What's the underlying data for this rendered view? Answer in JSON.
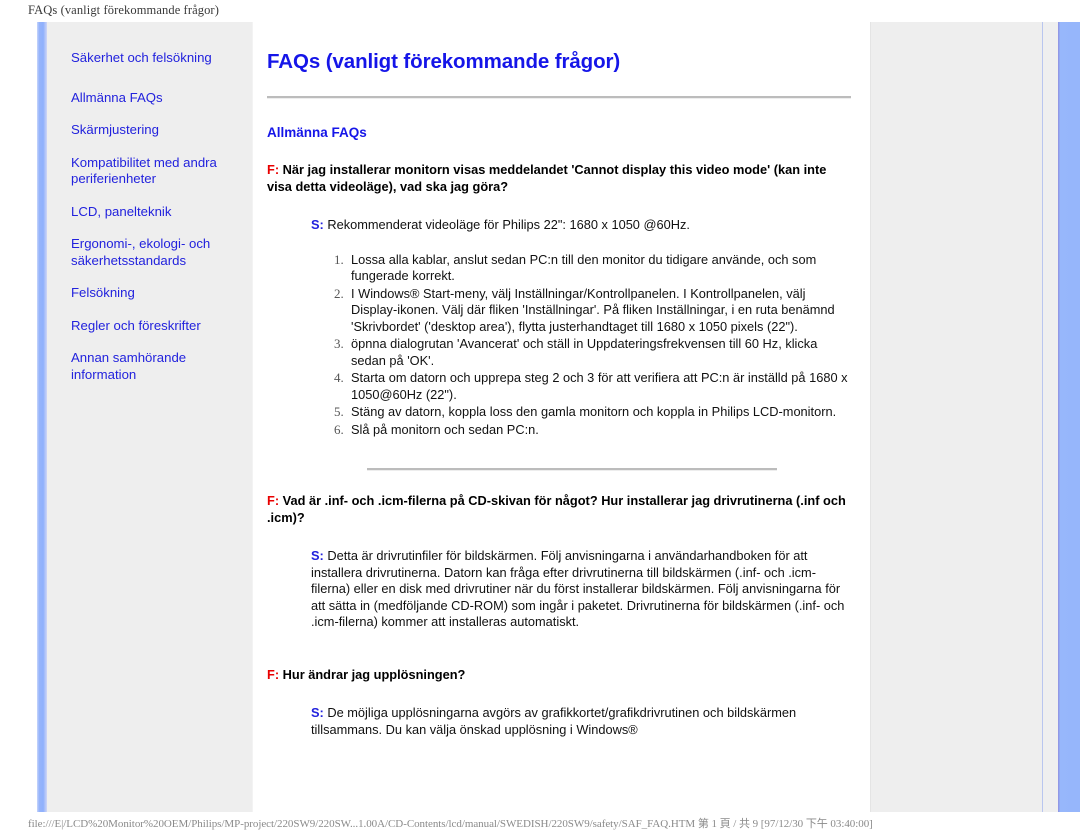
{
  "window": {
    "caption": "FAQs (vanligt förekommande frågor)",
    "footer": "file:///E|/LCD%20Monitor%20OEM/Philips/MP-project/220SW9/220SW...1.00A/CD-Contents/lcd/manual/SWEDISH/220SW9/safety/SAF_FAQ.HTM 第 1 頁 / 共 9 [97/12/30 下午 03:40:00]"
  },
  "colors": {
    "link": "#2222dd",
    "title": "#1515e8",
    "question_marker": "#e80000",
    "answer_marker": "#2222dd",
    "sidebar_bg": "#eeeeee",
    "accent_bar": "#96b4fb"
  },
  "sidebar": {
    "items": [
      {
        "label": "Säkerhet och felsökning"
      },
      {
        "label": "Allmänna FAQs"
      },
      {
        "label": "Skärmjustering"
      },
      {
        "label": "Kompatibilitet med andra periferienheter"
      },
      {
        "label": "LCD, panelteknik"
      },
      {
        "label": "Ergonomi-, ekologi- och säkerhetsstandards"
      },
      {
        "label": "Felsökning"
      },
      {
        "label": "Regler och föreskrifter"
      },
      {
        "label": "Annan samhörande information"
      }
    ]
  },
  "main": {
    "title": "FAQs (vanligt förekommande frågor)",
    "section_title": "Allmänna FAQs",
    "q_marker": "F:",
    "a_marker": "S:",
    "qa": [
      {
        "question": "När jag installerar monitorn visas meddelandet 'Cannot display this video mode' (kan inte visa detta videoläge), vad ska jag göra?",
        "answer": "Rekommenderat videoläge för Philips 22\": 1680 x 1050 @60Hz.",
        "steps": [
          "Lossa alla kablar, anslut sedan PC:n till den monitor du tidigare använde, och som fungerade korrekt.",
          "I Windows® Start-meny, välj Inställningar/Kontrollpanelen. I Kontrollpanelen, välj Display-ikonen. Välj där fliken 'Inställningar'. På fliken Inställningar, i en ruta benämnd 'Skrivbordet' ('desktop area'), flytta justerhandtaget till 1680 x 1050 pixels (22\").",
          "öpnna dialogrutan 'Avancerat' och ställ in Uppdateringsfrekvensen till 60 Hz, klicka sedan på 'OK'.",
          "Starta om datorn och upprepa steg 2 och 3 för att verifiera att PC:n är inställd på 1680 x 1050@60Hz (22\").",
          "Stäng av datorn, koppla loss den gamla monitorn och koppla in Philips LCD-monitorn.",
          "Slå på monitorn och sedan PC:n."
        ]
      },
      {
        "question": "Vad är .inf- och .icm-filerna på CD-skivan för något? Hur installerar jag drivrutinerna (.inf och .icm)?",
        "answer": "Detta är drivrutinfiler för bildskärmen. Följ anvisningarna i användarhandboken för att installera drivrutinerna. Datorn kan fråga efter drivrutinerna till bildskärmen (.inf- och .icm-filerna) eller en disk med drivrutiner när du först installerar bildskärmen. Följ anvisningarna för att sätta in (medföljande CD-ROM) som ingår i paketet. Drivrutinerna för bildskärmen (.inf- och .icm-filerna) kommer att installeras automatiskt.",
        "steps": []
      },
      {
        "question": "Hur ändrar jag upplösningen?",
        "answer": "De möjliga upplösningarna avgörs av grafikkortet/grafikdrivrutinen och bildskärmen tillsammans. Du kan välja önskad upplösning i Windows®",
        "steps": []
      }
    ]
  }
}
